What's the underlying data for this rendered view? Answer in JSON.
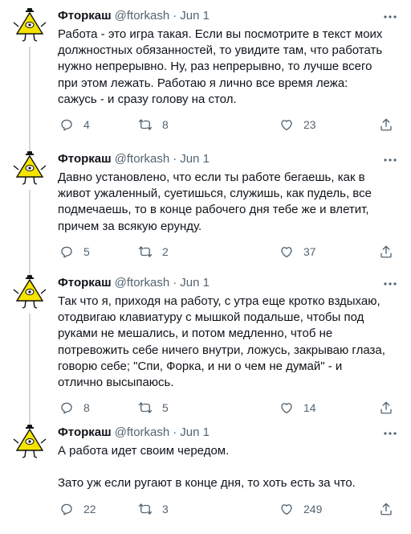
{
  "icons": {
    "avatar": "bill-cipher-avatar-icon",
    "more": "more-horizontal-icon",
    "reply": "reply-icon",
    "retweet": "retweet-icon",
    "like": "heart-icon",
    "share": "share-icon"
  },
  "colors": {
    "secondary_text": "#536471",
    "thread_line": "#cfd9de",
    "avatar_yellow": "#f5e300"
  },
  "tweets": [
    {
      "name": "Фторкаш",
      "handle": "@ftorkash",
      "separator": "·",
      "date": "Jun 1",
      "text": "Работа - это игра такая. Если вы посмотрите в текст моих должностных обязанностей, то увидите там, что работать нужно непрерывно. Ну, раз непрерывно, то лучше всего при этом лежать. Работаю я лично все время лежа: сажусь - и сразу голову на стол.",
      "replies": "4",
      "retweets": "8",
      "likes": "23"
    },
    {
      "name": "Фторкаш",
      "handle": "@ftorkash",
      "separator": "·",
      "date": "Jun 1",
      "text": "Давно установлено, что если ты работе бегаешь, как в живот ужаленный, суетишься, служишь, как пудель, все подмечаешь, то в конце рабочего дня тебе же и влетит, причем за всякую ерунду.",
      "replies": "5",
      "retweets": "2",
      "likes": "37"
    },
    {
      "name": "Фторкаш",
      "handle": "@ftorkash",
      "separator": "·",
      "date": "Jun 1",
      "text": "Так что я, приходя на работу, с утра еще кротко вздыхаю, отодвигаю клавиатуру с мышкой подальше, чтобы под руками не мешались, и потом медленно, чтоб не потревожить себе ничего внутри, ложусь, закрываю глаза, говорю себе; \"Спи, Форка, и ни о чем не думай\" - и отлично высыпаюсь.",
      "replies": "8",
      "retweets": "5",
      "likes": "14"
    },
    {
      "name": "Фторкаш",
      "handle": "@ftorkash",
      "separator": "·",
      "date": "Jun 1",
      "text": "А работа идет своим чередом.\n\nЗато уж если ругают в конце дня, то хоть есть за что.",
      "replies": "22",
      "retweets": "3",
      "likes": "249"
    }
  ]
}
